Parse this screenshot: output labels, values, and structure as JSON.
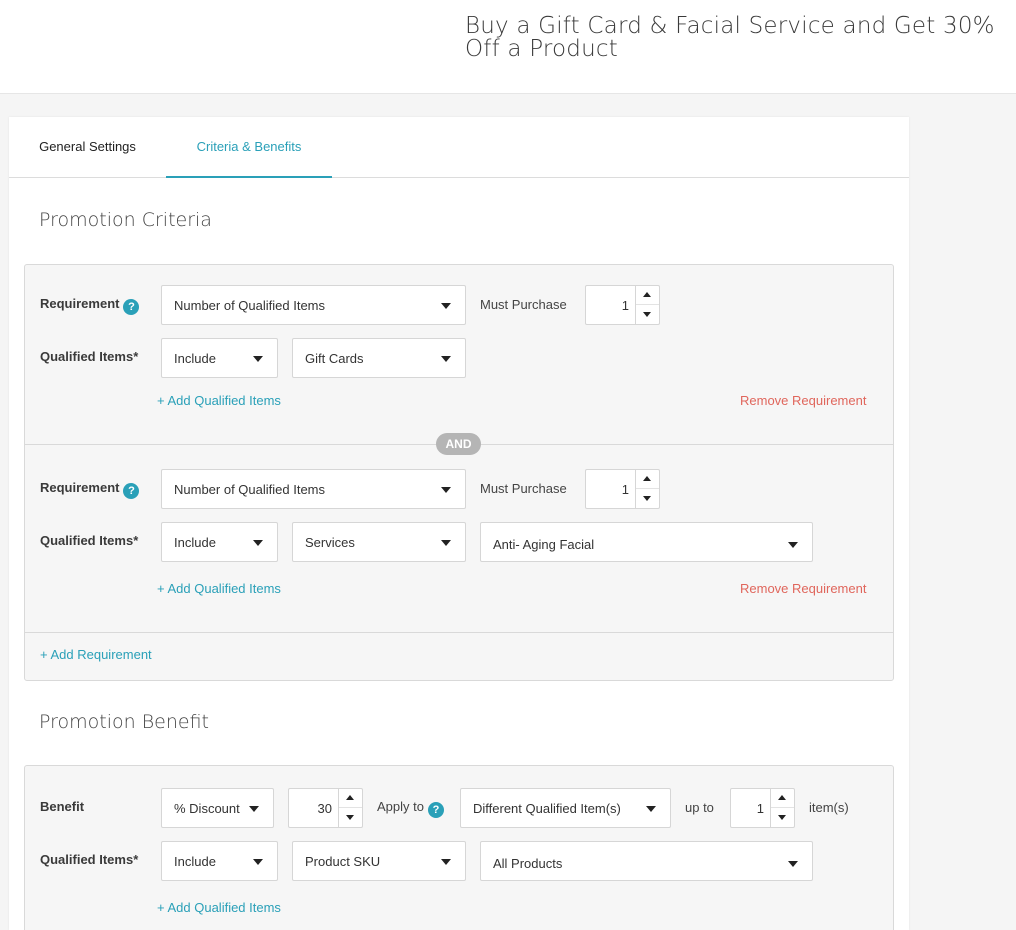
{
  "header": {
    "title": "Buy a Gift Card & Facial Service and Get 30% Off a Product"
  },
  "tabs": [
    {
      "label": "General Settings",
      "active": false
    },
    {
      "label": "Criteria & Benefits",
      "active": true
    }
  ],
  "criteria": {
    "title": "Promotion Criteria",
    "requirements": [
      {
        "requirement_label": "Requirement",
        "requirement_value": "Number of Qualified Items",
        "must_purchase_label": "Must Purchase",
        "must_purchase_value": "1",
        "qualified_label": "Qualified Items*",
        "include_value": "Include",
        "category_value": "Gift Cards",
        "add_items_link": "+ Add Qualified Items",
        "remove_link": "Remove Requirement"
      },
      {
        "requirement_label": "Requirement",
        "requirement_value": "Number of Qualified Items",
        "must_purchase_label": "Must Purchase",
        "must_purchase_value": "1",
        "qualified_label": "Qualified Items*",
        "include_value": "Include",
        "category_value": "Services",
        "item_value": "Anti- Aging Facial",
        "add_items_link": "+ Add Qualified Items",
        "remove_link": "Remove Requirement"
      }
    ],
    "and_badge": "AND",
    "add_requirement_link": "+ Add Requirement"
  },
  "benefit": {
    "title": "Promotion Benefit",
    "benefit_label": "Benefit",
    "discount_type": "% Discount",
    "discount_value": "30",
    "apply_to_label": "Apply to",
    "apply_to_value": "Different Qualified Item(s)",
    "up_to_label": "up to",
    "up_to_value": "1",
    "items_suffix": "item(s)",
    "qualified_label": "Qualified Items*",
    "include_value": "Include",
    "category_value": "Product SKU",
    "item_value": "All Products",
    "add_items_link": "+ Add Qualified Items"
  },
  "icons": {
    "help": "help-icon",
    "dropdown": "caret-down-icon"
  },
  "colors": {
    "accent": "#2aa0b8",
    "danger": "#e0665c",
    "badge": "#b5b5b5"
  }
}
